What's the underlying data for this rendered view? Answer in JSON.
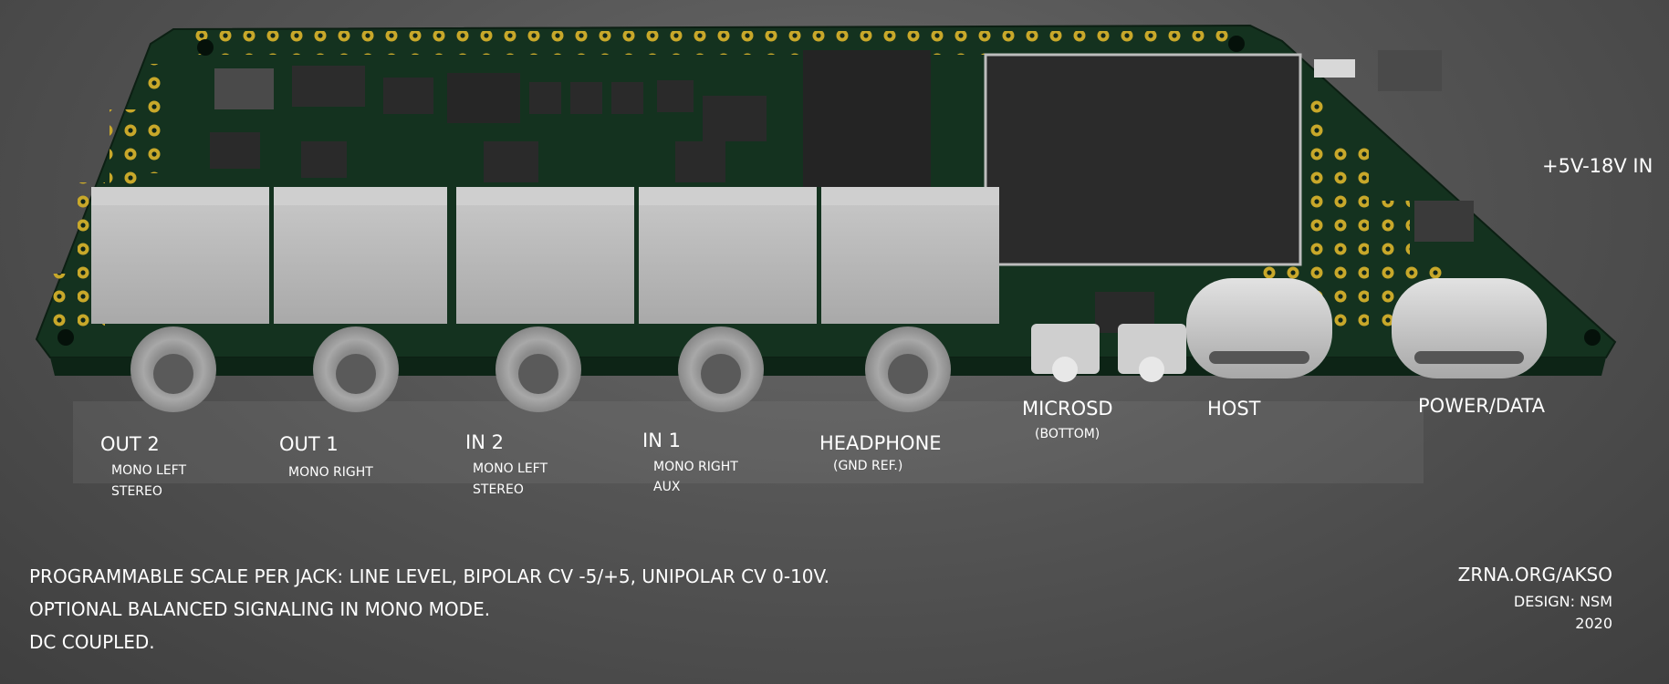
{
  "labels": {
    "out2": {
      "title": "OUT 2",
      "sub1": "MONO LEFT",
      "sub2": "STEREO"
    },
    "out1": {
      "title": "OUT 1",
      "sub1": "MONO RIGHT"
    },
    "in2": {
      "title": "IN 2",
      "sub1": "MONO LEFT",
      "sub2": "STEREO"
    },
    "in1": {
      "title": "IN 1",
      "sub1": "MONO RIGHT",
      "sub2": "AUX"
    },
    "headphone": {
      "title": "HEADPHONE",
      "sub1": "(GND REF.)"
    },
    "microsd": {
      "title": "MICROSD",
      "sub1": "(BOTTOM)"
    },
    "host": {
      "title": "HOST"
    },
    "power": {
      "title": "POWER/DATA"
    },
    "vin": "+5V-18V IN"
  },
  "notes": [
    "PROGRAMMABLE SCALE PER JACK: LINE LEVEL, BIPOLAR CV -5/+5, UNIPOLAR CV 0-10V.",
    "OPTIONAL BALANCED SIGNALING IN MONO MODE.",
    "DC COUPLED."
  ],
  "credits": {
    "url": "ZRNA.ORG/AKSO",
    "design": "DESIGN: NSM",
    "year": "2020"
  },
  "colors": {
    "pcb": "#14321f",
    "pad": "#c8a82a",
    "jack": "#b9b9b9",
    "chip": "#2a2a2a"
  }
}
